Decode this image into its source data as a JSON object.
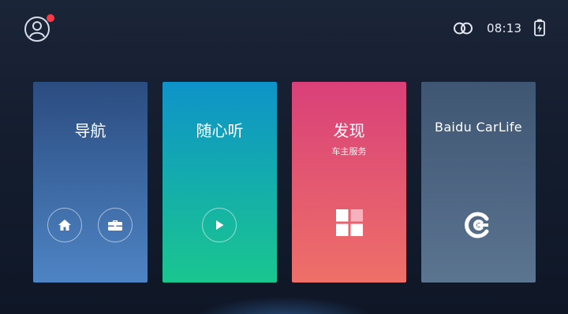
{
  "status_bar": {
    "time": "08:13"
  },
  "cards": {
    "navigation": {
      "title": "导航"
    },
    "music": {
      "title": "随心听"
    },
    "discover": {
      "title": "发现",
      "subtitle": "车主服务"
    },
    "carlife": {
      "title": "Baidu CarLife"
    }
  },
  "icons": {
    "avatar": "user-avatar-icon",
    "link": "link-icon",
    "battery": "battery-charging-icon",
    "home": "home-icon",
    "work": "briefcase-icon",
    "play": "play-icon",
    "grid": "apps-grid-icon",
    "carlife": "carlife-logo"
  },
  "colors": {
    "background": "#141d2e",
    "notification_dot": "#f43b47",
    "nav_card": [
      "#2b4c80",
      "#4e84c4"
    ],
    "music_card": [
      "#0e93c9",
      "#1ac68f"
    ],
    "discover_card": [
      "#d94079",
      "#ee7068"
    ],
    "carlife_card": [
      "#3f5673",
      "#5b7490"
    ]
  }
}
